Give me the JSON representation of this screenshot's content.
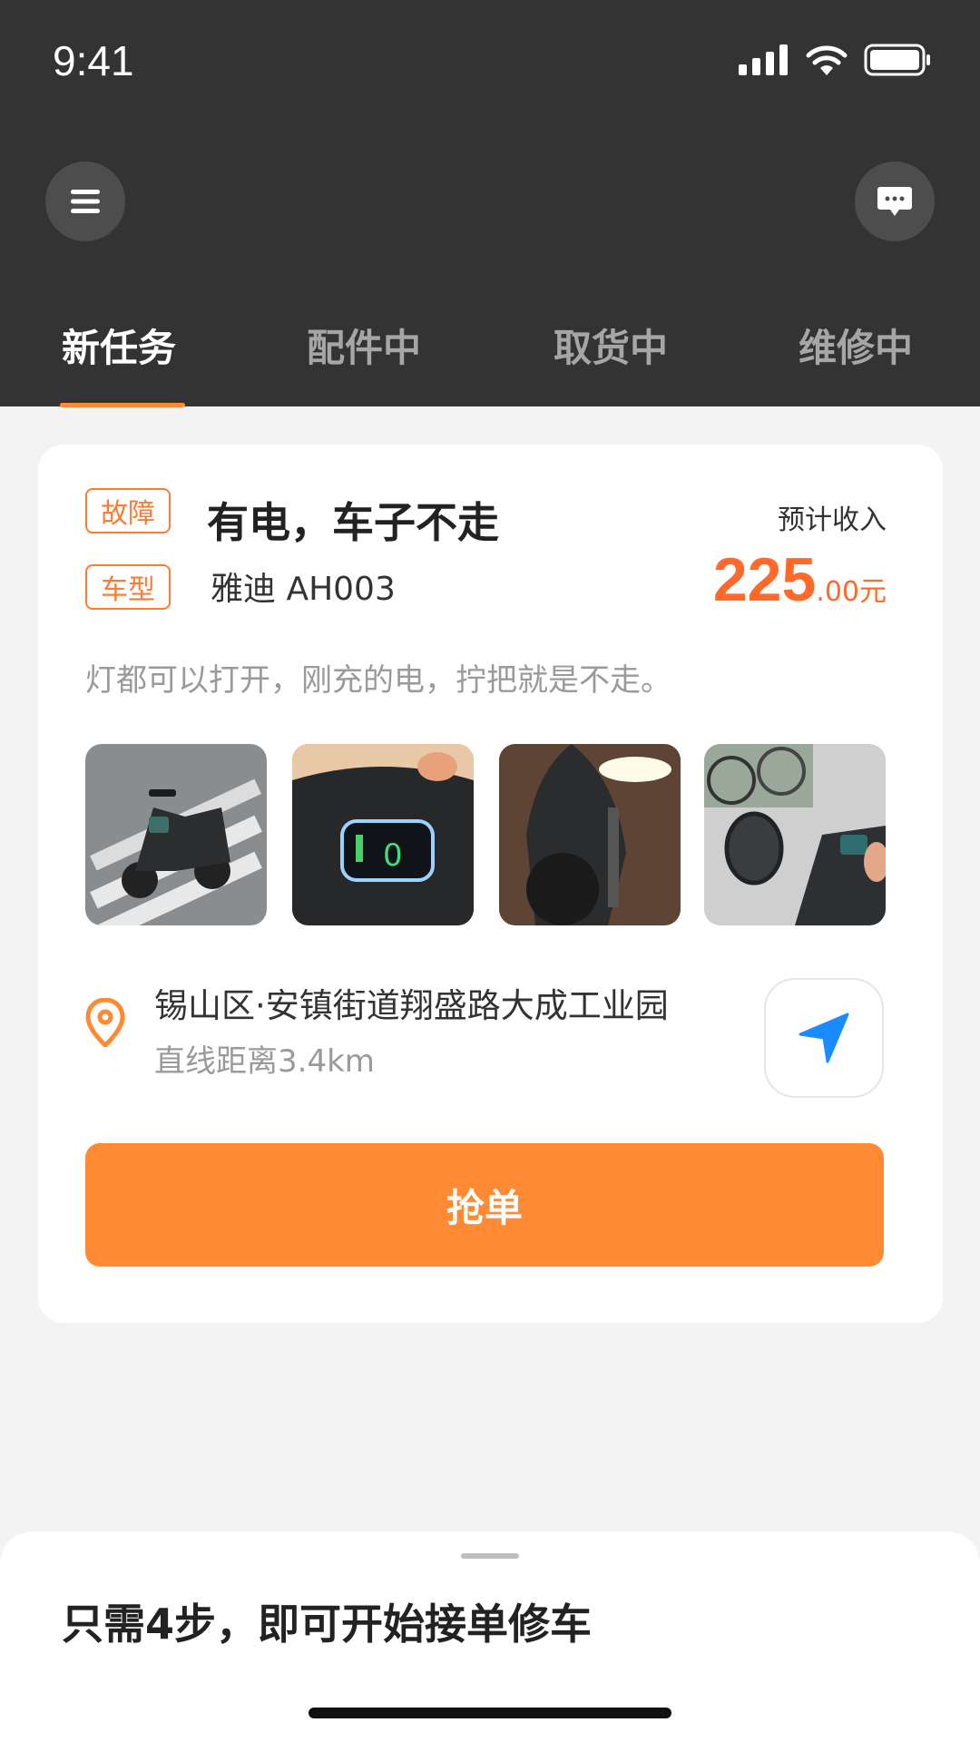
{
  "status": {
    "time": "9:41"
  },
  "header": {
    "menu_icon": "menu-icon",
    "message_icon": "message-icon"
  },
  "tabs": [
    {
      "label": "新任务",
      "active": true
    },
    {
      "label": "配件中",
      "active": false
    },
    {
      "label": "取货中",
      "active": false
    },
    {
      "label": "维修中",
      "active": false
    }
  ],
  "task": {
    "fault_tag": "故障",
    "title": "有电，车子不走",
    "model_tag": "车型",
    "model": "雅迪  AH003",
    "income_label": "预计收入",
    "price_int": "225",
    "price_dec": ".00元",
    "description": "灯都可以打开，刚充的电，拧把就是不走。",
    "photos": [
      "scooter-crosswalk-photo",
      "scooter-dashboard-photo",
      "scooter-headlight-photo",
      "scooter-handlebar-photo"
    ],
    "address": "锡山区·安镇街道翔盛路大成工业园",
    "distance": "直线距离3.4km",
    "grab_button": "抢单"
  },
  "sheet": {
    "title": "只需4步，即可开始接单修车"
  },
  "colors": {
    "accent": "#ff8a33",
    "price": "#ff6a2a",
    "header_bg": "#333333",
    "nav_blue": "#1a8cff"
  }
}
